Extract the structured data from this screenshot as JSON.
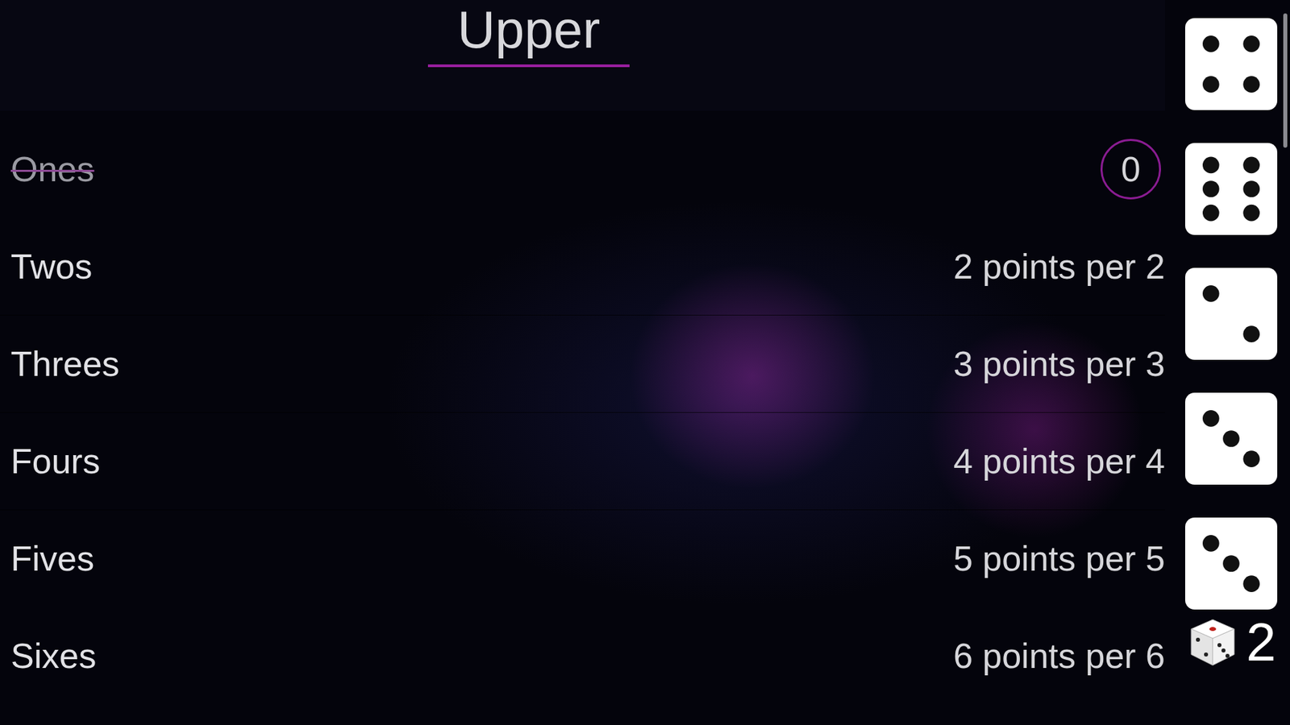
{
  "header": {
    "title": "Upper"
  },
  "categories": [
    {
      "name": "Ones",
      "used": true,
      "kind": "scored",
      "score": "0"
    },
    {
      "name": "Twos",
      "used": false,
      "kind": "open",
      "hint": "2 points per 2"
    },
    {
      "name": "Threes",
      "used": false,
      "kind": "open",
      "hint": "3 points per 3"
    },
    {
      "name": "Fours",
      "used": false,
      "kind": "open",
      "hint": "4 points per 4"
    },
    {
      "name": "Fives",
      "used": false,
      "kind": "open",
      "hint": "5 points per 5"
    },
    {
      "name": "Sixes",
      "used": false,
      "kind": "open",
      "hint": "6 points per 6"
    }
  ],
  "dice": [
    {
      "value": 4,
      "held": false
    },
    {
      "value": 6,
      "held": false
    },
    {
      "value": 2,
      "held": false
    },
    {
      "value": 3,
      "held": false
    },
    {
      "value": 3,
      "held": false
    }
  ],
  "rolls_left": "2"
}
